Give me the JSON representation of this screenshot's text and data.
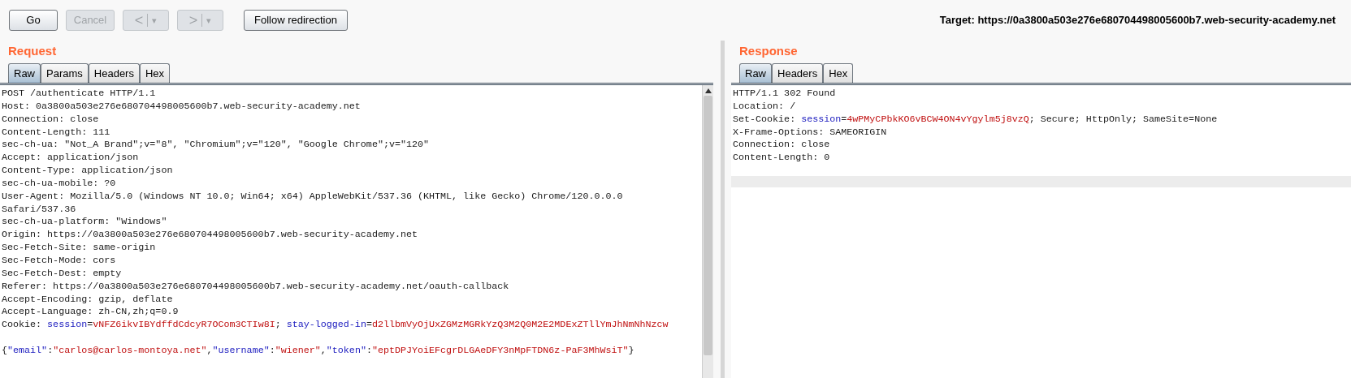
{
  "toolbar": {
    "buttons": [
      {
        "kind": "text",
        "label": "Go",
        "disabled": false
      },
      {
        "kind": "text",
        "label": "Cancel",
        "disabled": true
      },
      {
        "kind": "history",
        "label": "<",
        "menu": "▾",
        "disabled": true
      },
      {
        "kind": "history",
        "label": ">",
        "menu": "▾",
        "disabled": true
      },
      {
        "kind": "text",
        "label": "Follow redirection",
        "disabled": false
      }
    ],
    "target": "Target: https://0a3800a503e276e680704498005600b7.web-security-academy.net"
  },
  "request": {
    "title": "Request",
    "tabs": [
      {
        "label": "Raw",
        "selected": true
      },
      {
        "label": "Params",
        "selected": false
      },
      {
        "label": "Headers",
        "selected": false
      },
      {
        "label": "Hex",
        "selected": false
      }
    ],
    "lines": [
      [
        {
          "kind": "plain",
          "text": "POST /authenticate HTTP/1.1"
        }
      ],
      [
        {
          "kind": "plain",
          "text": "Host: 0a3800a503e276e680704498005600b7.web-security-academy.net"
        }
      ],
      [
        {
          "kind": "plain",
          "text": "Connection: close"
        }
      ],
      [
        {
          "kind": "plain",
          "text": "Content-Length: 111"
        }
      ],
      [
        {
          "kind": "plain",
          "text": "sec-ch-ua: \"Not_A Brand\";v=\"8\", \"Chromium\";v=\"120\", \"Google Chrome\";v=\"120\""
        }
      ],
      [
        {
          "kind": "plain",
          "text": "Accept: application/json"
        }
      ],
      [
        {
          "kind": "plain",
          "text": "Content-Type: application/json"
        }
      ],
      [
        {
          "kind": "plain",
          "text": "sec-ch-ua-mobile: ?0"
        }
      ],
      [
        {
          "kind": "plain",
          "text": "User-Agent: Mozilla/5.0 (Windows NT 10.0; Win64; x64) AppleWebKit/537.36 (KHTML, like Gecko) Chrome/120.0.0.0"
        }
      ],
      [
        {
          "kind": "plain",
          "text": "Safari/537.36"
        }
      ],
      [
        {
          "kind": "plain",
          "text": "sec-ch-ua-platform: \"Windows\""
        }
      ],
      [
        {
          "kind": "plain",
          "text": "Origin: https://0a3800a503e276e680704498005600b7.web-security-academy.net"
        }
      ],
      [
        {
          "kind": "plain",
          "text": "Sec-Fetch-Site: same-origin"
        }
      ],
      [
        {
          "kind": "plain",
          "text": "Sec-Fetch-Mode: cors"
        }
      ],
      [
        {
          "kind": "plain",
          "text": "Sec-Fetch-Dest: empty"
        }
      ],
      [
        {
          "kind": "plain",
          "text": "Referer: https://0a3800a503e276e680704498005600b7.web-security-academy.net/oauth-callback"
        }
      ],
      [
        {
          "kind": "plain",
          "text": "Accept-Encoding: gzip, deflate"
        }
      ],
      [
        {
          "kind": "plain",
          "text": "Accept-Language: zh-CN,zh;q=0.9"
        }
      ],
      [
        {
          "kind": "plain",
          "text": "Cookie: "
        },
        {
          "kind": "key",
          "text": "session"
        },
        {
          "kind": "plain",
          "text": "="
        },
        {
          "kind": "value",
          "text": "vNFZ6ikvIBYdffdCdcyR7OCom3CTIw8I"
        },
        {
          "kind": "plain",
          "text": "; "
        },
        {
          "kind": "key",
          "text": "stay-logged-in"
        },
        {
          "kind": "plain",
          "text": "="
        },
        {
          "kind": "value",
          "text": "d2llbmVyOjUxZGMzMGRkYzQ3M2Q0M2E2MDExZTllYmJhNmNhNzcw"
        }
      ]
    ],
    "body": [
      [
        {
          "kind": "plain",
          "text": "{"
        },
        {
          "kind": "key",
          "text": "\"email\""
        },
        {
          "kind": "plain",
          "text": ":"
        },
        {
          "kind": "value",
          "text": "\"carlos@carlos-montoya.net\""
        },
        {
          "kind": "plain",
          "text": ","
        },
        {
          "kind": "key",
          "text": "\"username\""
        },
        {
          "kind": "plain",
          "text": ":"
        },
        {
          "kind": "value",
          "text": "\"wiener\""
        },
        {
          "kind": "plain",
          "text": ","
        },
        {
          "kind": "key",
          "text": "\"token\""
        },
        {
          "kind": "plain",
          "text": ":"
        },
        {
          "kind": "value",
          "text": "\"eptDPJYoiEFcgrDLGAeDFY3nMpFTDN6z-PaF3MhWsiT\""
        },
        {
          "kind": "plain",
          "text": "}"
        }
      ]
    ]
  },
  "response": {
    "title": "Response",
    "tabs": [
      {
        "label": "Raw",
        "selected": true
      },
      {
        "label": "Headers",
        "selected": false
      },
      {
        "label": "Hex",
        "selected": false
      }
    ],
    "lines": [
      [
        {
          "kind": "plain",
          "text": "HTTP/1.1 302 Found"
        }
      ],
      [
        {
          "kind": "plain",
          "text": "Location: /"
        }
      ],
      [
        {
          "kind": "plain",
          "text": "Set-Cookie: "
        },
        {
          "kind": "key",
          "text": "session"
        },
        {
          "kind": "plain",
          "text": "="
        },
        {
          "kind": "value",
          "text": "4wPMyCPbkKO6vBCW4ON4vYgylm5j8vzQ"
        },
        {
          "kind": "plain",
          "text": "; Secure; HttpOnly; SameSite=None"
        }
      ],
      [
        {
          "kind": "plain",
          "text": "X-Frame-Options: SAMEORIGIN"
        }
      ],
      [
        {
          "kind": "plain",
          "text": "Connection: close"
        }
      ],
      [
        {
          "kind": "plain",
          "text": "Content-Length: 0"
        }
      ]
    ]
  }
}
